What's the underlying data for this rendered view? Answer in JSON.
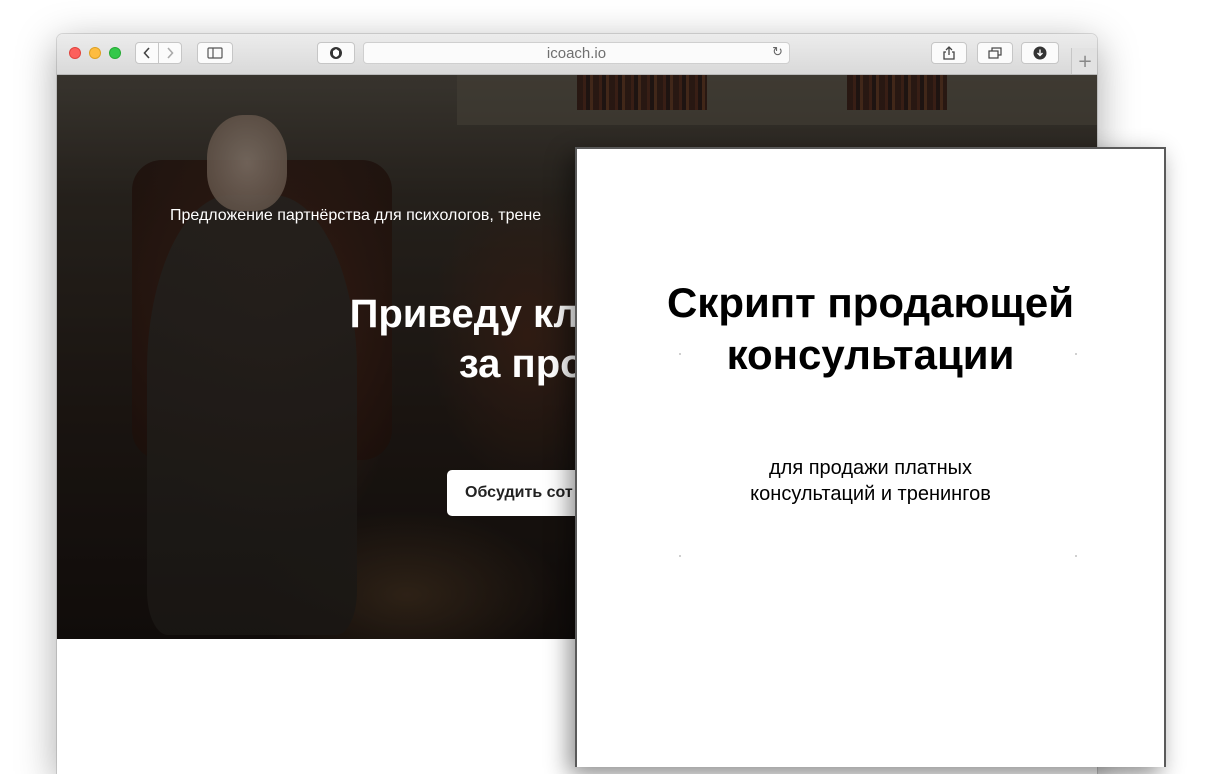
{
  "browser": {
    "url": "icoach.io",
    "icons": {
      "back": "chevron-left-icon",
      "forward": "chevron-right-icon",
      "sidebar": "sidebar-icon",
      "privacy": "privacy-shield-icon",
      "reload": "reload-icon",
      "share": "share-icon",
      "tabs": "tabs-overview-icon",
      "download": "download-icon",
      "new_tab": "plus-icon"
    }
  },
  "hero": {
    "subtitle": "Предложение партнёрства для психологов, трене",
    "title": "Приведу клиентов к п\nза процент",
    "cta_label": "Обсудить сот"
  },
  "document": {
    "title": "Скрипт продающей\nконсультации",
    "subtitle": "для продажи платных\nконсультаций и тренингов"
  }
}
